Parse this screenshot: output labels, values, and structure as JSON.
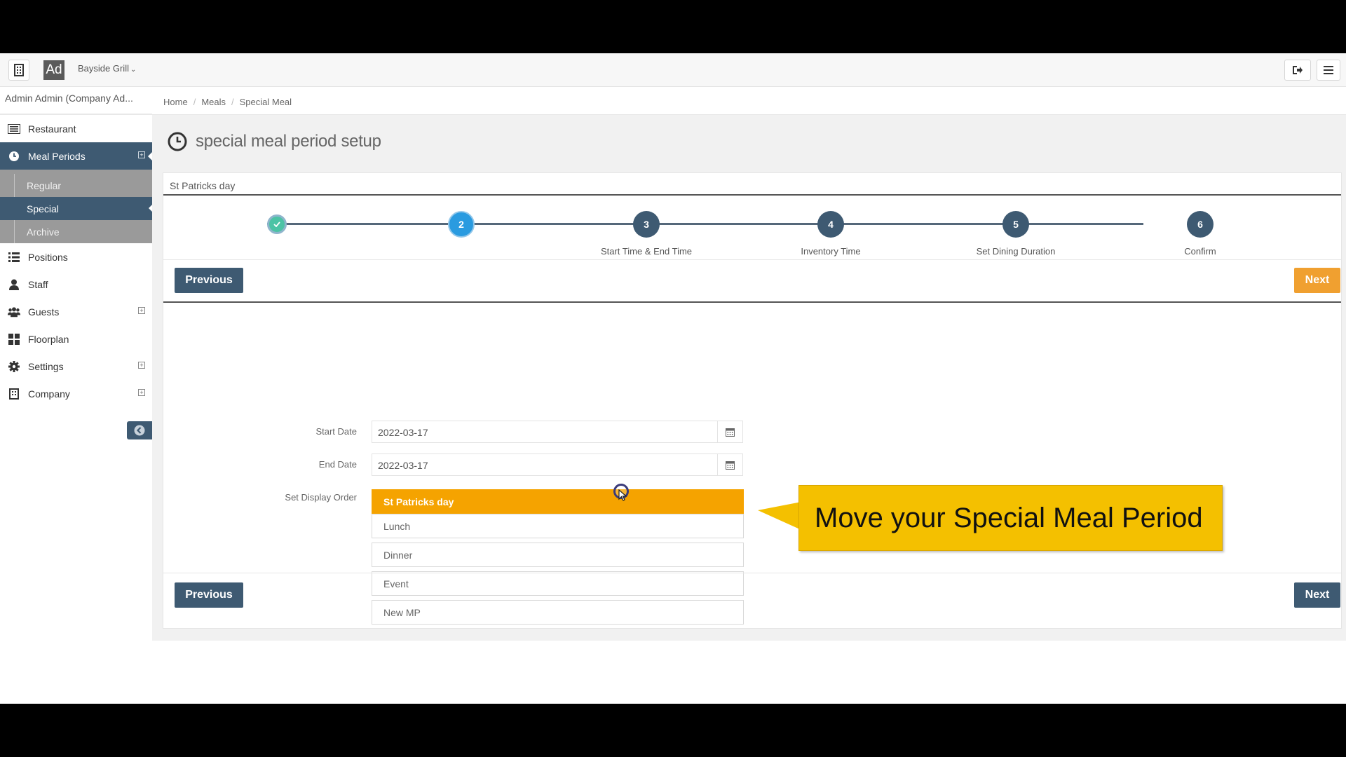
{
  "topbar": {
    "avatar_initials": "Ad",
    "restaurant_name": "Bayside Grill",
    "caret": "⌄"
  },
  "sidebar": {
    "user_name": "Admin Admin (Company Ad...",
    "items": [
      {
        "label": "Restaurant",
        "icon": "list-icon"
      },
      {
        "label": "Meal Periods",
        "icon": "clock-icon"
      },
      {
        "label": "Positions",
        "icon": "list-icon"
      },
      {
        "label": "Staff",
        "icon": "user-icon"
      },
      {
        "label": "Guests",
        "icon": "users-icon"
      },
      {
        "label": "Floorplan",
        "icon": "grid-icon"
      },
      {
        "label": "Settings",
        "icon": "gear-icon"
      },
      {
        "label": "Company",
        "icon": "building-icon"
      }
    ],
    "submenu": [
      {
        "label": "Regular"
      },
      {
        "label": "Special"
      },
      {
        "label": "Archive"
      }
    ],
    "plus": "+"
  },
  "breadcrumb": {
    "items": [
      "Home",
      "Meals",
      "Special Meal"
    ],
    "separator": "/"
  },
  "page": {
    "title": "special meal period setup",
    "panel_title": "St Patricks day"
  },
  "wizard": {
    "steps": [
      {
        "number": "",
        "label": "",
        "state": "done"
      },
      {
        "number": "2",
        "label": "",
        "state": "current"
      },
      {
        "number": "3",
        "label": "Start Time & End Time",
        "state": "pending"
      },
      {
        "number": "4",
        "label": "Inventory Time",
        "state": "pending"
      },
      {
        "number": "5",
        "label": "Set Dining Duration",
        "state": "pending"
      },
      {
        "number": "6",
        "label": "Confirm",
        "state": "pending"
      }
    ]
  },
  "buttons": {
    "previous": "Previous",
    "next": "Next"
  },
  "form": {
    "start_date_label": "Start Date",
    "start_date_value": "2022-03-17",
    "end_date_label": "End Date",
    "end_date_value": "2022-03-17",
    "display_order_label": "Set Display Order",
    "display_order": [
      "St Patricks day",
      "Lunch",
      "Dinner",
      "Event",
      "New MP"
    ]
  },
  "callout": {
    "text": "Move your Special Meal Period"
  },
  "colors": {
    "primary": "#3e5a72",
    "accent_orange": "#f0a030",
    "selected_row": "#f5a300",
    "callout": "#f4c000",
    "step_current": "#2a9be0",
    "step_done": "#4cc3a5"
  }
}
